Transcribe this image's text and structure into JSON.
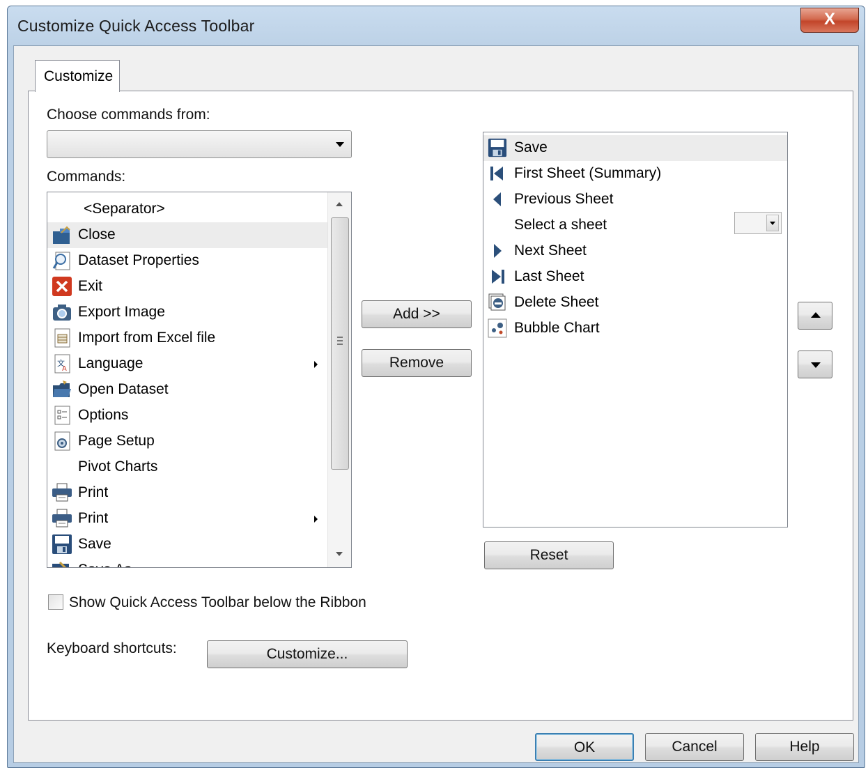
{
  "window": {
    "title": "Customize Quick Access Toolbar",
    "close_label": "X"
  },
  "tab": {
    "label": "Customize"
  },
  "choose": {
    "label": "Choose commands from:",
    "value": ""
  },
  "commands": {
    "label": "Commands:",
    "items": [
      {
        "label": "<Separator>",
        "icon": "none",
        "submenu": false
      },
      {
        "label": "Close",
        "icon": "close-dataset-icon",
        "submenu": false
      },
      {
        "label": "Dataset Properties",
        "icon": "dataset-properties-icon",
        "submenu": false
      },
      {
        "label": "Exit",
        "icon": "exit-icon",
        "submenu": false
      },
      {
        "label": "Export Image",
        "icon": "camera-icon",
        "submenu": false
      },
      {
        "label": "Import from Excel file",
        "icon": "import-excel-icon",
        "submenu": false
      },
      {
        "label": "Language",
        "icon": "language-icon",
        "submenu": true
      },
      {
        "label": "Open Dataset",
        "icon": "open-folder-icon",
        "submenu": false
      },
      {
        "label": "Options",
        "icon": "options-icon",
        "submenu": false
      },
      {
        "label": "Page Setup",
        "icon": "page-setup-icon",
        "submenu": false
      },
      {
        "label": "Pivot Charts",
        "icon": "none",
        "submenu": false
      },
      {
        "label": "Print",
        "icon": "printer-icon",
        "submenu": false
      },
      {
        "label": "Print",
        "icon": "printer-icon",
        "submenu": true
      },
      {
        "label": "Save",
        "icon": "save-icon",
        "submenu": false
      },
      {
        "label": "Save As",
        "icon": "save-as-icon",
        "submenu": false
      }
    ]
  },
  "buttons": {
    "add": "Add >>",
    "remove": "Remove",
    "reset": "Reset",
    "customize": "Customize...",
    "ok": "OK",
    "cancel": "Cancel",
    "help": "Help"
  },
  "qat": {
    "items": [
      {
        "label": "Save",
        "icon": "save-icon"
      },
      {
        "label": "First Sheet (Summary)",
        "icon": "first-sheet-icon"
      },
      {
        "label": "Previous Sheet",
        "icon": "previous-sheet-icon"
      },
      {
        "label": "Select a sheet",
        "icon": "none"
      },
      {
        "label": "Next Sheet",
        "icon": "next-sheet-icon"
      },
      {
        "label": "Last Sheet",
        "icon": "last-sheet-icon"
      },
      {
        "label": "Delete Sheet",
        "icon": "delete-sheet-icon"
      },
      {
        "label": "Bubble Chart",
        "icon": "bubble-chart-icon"
      }
    ]
  },
  "show_below": {
    "label": "Show Quick Access Toolbar below the Ribbon",
    "checked": false
  },
  "keyboard": {
    "label": "Keyboard shortcuts:"
  }
}
